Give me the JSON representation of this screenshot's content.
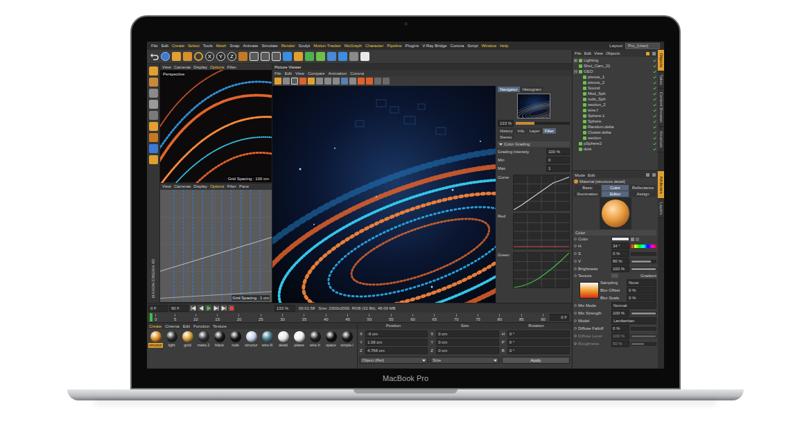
{
  "device": {
    "label": "MacBook Pro"
  },
  "menu_bar": {
    "items": [
      {
        "label": "File",
        "color": "#d6d6d6"
      },
      {
        "label": "Edit",
        "color": "#d6d6d6"
      },
      {
        "label": "Create",
        "color": "#e8c547"
      },
      {
        "label": "Select",
        "color": "#e8c547"
      },
      {
        "label": "Tools",
        "color": "#d6d6d6"
      },
      {
        "label": "Mesh",
        "color": "#e8c547"
      },
      {
        "label": "Snap",
        "color": "#d6d6d6"
      },
      {
        "label": "Animate",
        "color": "#d6d6d6"
      },
      {
        "label": "Simulate",
        "color": "#d6d6d6"
      },
      {
        "label": "Render",
        "color": "#e8c547"
      },
      {
        "label": "Sculpt",
        "color": "#d6d6d6"
      },
      {
        "label": "Motion Tracker",
        "color": "#e8c547"
      },
      {
        "label": "MoGraph",
        "color": "#e8c547"
      },
      {
        "label": "Character",
        "color": "#e8c547"
      },
      {
        "label": "Pipeline",
        "color": "#e8c547"
      },
      {
        "label": "Plugins",
        "color": "#d6d6d6"
      },
      {
        "label": "V-Ray Bridge",
        "color": "#d6d6d6"
      },
      {
        "label": "Corona",
        "color": "#d6d6d6"
      },
      {
        "label": "Script",
        "color": "#d6d6d6"
      },
      {
        "label": "Window",
        "color": "#e8c547"
      },
      {
        "label": "Help",
        "color": "#e8c547"
      }
    ],
    "layout_label": "Layout:",
    "layout_value": "Pro_(User)"
  },
  "toolbar": {
    "axes": [
      "X",
      "Y",
      "Z"
    ]
  },
  "brand": "MAXON CINEMA 4D",
  "viewports": [
    {
      "menu": [
        {
          "label": "View",
          "highlighted": false
        },
        {
          "label": "Cameras",
          "highlighted": false
        },
        {
          "label": "Display",
          "highlighted": false
        },
        {
          "label": "Options",
          "highlighted": true
        },
        {
          "label": "Filter",
          "highlighted": false
        }
      ],
      "label": "Perspective",
      "grid": "Grid Spacing : 100 cm"
    },
    {
      "menu": [
        {
          "label": "View",
          "highlighted": false
        },
        {
          "label": "Cameras",
          "highlighted": false
        },
        {
          "label": "Display",
          "highlighted": false
        },
        {
          "label": "Options",
          "highlighted": true
        },
        {
          "label": "Filter",
          "highlighted": false
        },
        {
          "label": "Pane",
          "highlighted": false
        }
      ],
      "grid": "Grid Spacing : 1 cm"
    }
  ],
  "picture_viewer": {
    "title": "Picture Viewer",
    "menu": [
      "File",
      "Edit",
      "View",
      "Compare",
      "Animation",
      "Corona"
    ],
    "side": {
      "tabs": [
        {
          "label": "Navigator",
          "selected": true
        },
        {
          "label": "Histogram",
          "selected": false
        }
      ],
      "zoom": "133 %",
      "zoom_level": 0.35,
      "tabs2": [
        {
          "label": "History",
          "selected": false
        },
        {
          "label": "Info",
          "selected": false
        },
        {
          "label": "Layer",
          "selected": false
        },
        {
          "label": "Filter",
          "selected": true
        },
        {
          "label": "Stereo",
          "selected": false
        }
      ],
      "section": "Color Grading",
      "fields": [
        {
          "label": "Grading Intensity",
          "value": "100 %"
        },
        {
          "label": "Min",
          "value": "0"
        },
        {
          "label": "Max",
          "value": "1"
        }
      ],
      "graphs": [
        {
          "label": "Curve",
          "color": "#d0d0d0",
          "values": [
            0,
            0.14,
            0.3,
            0.46,
            0.62,
            0.78,
            0.86,
            0.95
          ]
        },
        {
          "label": "Red",
          "color": "#d04848",
          "values": [
            0.06,
            0.06,
            0.06,
            0.06,
            0.06,
            0.06,
            0.06,
            0.06
          ]
        },
        {
          "label": "Green",
          "color": "#44c044",
          "values": [
            0,
            0.04,
            0.12,
            0.24,
            0.4,
            0.58,
            0.78,
            1
          ]
        }
      ]
    },
    "status": {
      "zoom": "133 %",
      "time": "00:01:58",
      "info": "Size: 2000x2000, RGB (32 Bit), 48.09 MB"
    }
  },
  "transport": {
    "start": "0 F",
    "end": "90 F"
  },
  "timeline": {
    "ticks": [
      "0",
      "5",
      "10",
      "15",
      "20",
      "25",
      "30",
      "35",
      "40",
      "45",
      "50",
      "55",
      "60",
      "65",
      "70",
      "75",
      "80",
      "85",
      "90"
    ],
    "playhead_level": 0,
    "current": "0 F"
  },
  "materials": {
    "menu": [
      {
        "label": "Create",
        "highlighted": true
      },
      {
        "label": "Cinema",
        "highlighted": false
      },
      {
        "label": "Edit",
        "highlighted": false
      },
      {
        "label": "Function",
        "highlighted": false
      },
      {
        "label": "Texture",
        "highlighted": false
      }
    ],
    "items": [
      {
        "label": "structur",
        "color": "#e0902c",
        "selected": true
      },
      {
        "label": "light",
        "color": "#2a2a2a",
        "selected": false
      },
      {
        "label": "gold",
        "color": "#d9a23a",
        "selected": false
      },
      {
        "label": "mass.2",
        "color": "#333333",
        "selected": false
      },
      {
        "label": "black",
        "color": "#1a1a1a",
        "selected": false
      },
      {
        "label": "rods",
        "color": "#151515",
        "selected": false
      },
      {
        "label": "structur",
        "color": "#c9d4ea",
        "selected": false
      },
      {
        "label": "wire.fil",
        "color": "#4a7d8c",
        "selected": false
      },
      {
        "label": "detail",
        "color": "#e8e8e8",
        "selected": false
      },
      {
        "label": "plates",
        "color": "#f0f0f0",
        "selected": false
      },
      {
        "label": "wire.fr",
        "color": "#202020",
        "selected": false
      },
      {
        "label": "space",
        "color": "#101010",
        "selected": false
      },
      {
        "label": "simple.l",
        "color": "#181818",
        "selected": false
      }
    ]
  },
  "coordinates": {
    "headers": [
      "Position",
      "Size",
      "Rotation"
    ],
    "rows": [
      {
        "pos_axis": "X",
        "pos": "-6 cm",
        "size_axis": "X",
        "size": "0 cm",
        "rot_axis": "H",
        "rot": "0 °"
      },
      {
        "pos_axis": "Y",
        "pos": "1.09 cm",
        "size_axis": "Y",
        "size": "0 cm",
        "rot_axis": "P",
        "rot": "0 °"
      },
      {
        "pos_axis": "Z",
        "pos": "4.766 cm",
        "size_axis": "Z",
        "size": "0 cm",
        "rot_axis": "B",
        "rot": "0 °"
      }
    ],
    "mode": "Object (Rel)",
    "size_mode": "Size",
    "apply": "Apply"
  },
  "objects": {
    "menu": [
      "File",
      "Edit",
      "View",
      "Objects"
    ],
    "items": [
      {
        "name": "Lighting",
        "expanded": false
      },
      {
        "name": "Shot_Cam_21"
      },
      {
        "name": "GEO",
        "expanded": true,
        "children": [
          {
            "name": "plexus_1"
          },
          {
            "name": "plexus_2"
          },
          {
            "name": "Sound"
          },
          {
            "name": "Mod_Sph"
          },
          {
            "name": "rods_Sph"
          },
          {
            "name": "section_2"
          },
          {
            "name": "wire.f"
          },
          {
            "name": "Sphere.1"
          },
          {
            "name": "Sphere"
          },
          {
            "name": "Random.delta"
          },
          {
            "name": "Cluster.delta"
          },
          {
            "name": "section"
          }
        ]
      },
      {
        "name": "pSphere2"
      },
      {
        "name": "dots"
      }
    ]
  },
  "attributes": {
    "menu": [
      "Mode",
      "Edit"
    ],
    "title": "Material [structure.detail]",
    "tabs": [
      {
        "label": "Basic",
        "selected": false
      },
      {
        "label": "Color",
        "selected": true
      },
      {
        "label": "Reflectance",
        "selected": false
      },
      {
        "label": "Illumination",
        "selected": false
      },
      {
        "label": "Editor",
        "selected": true
      },
      {
        "label": "Assign",
        "selected": false
      }
    ],
    "section": "Color",
    "rows": [
      {
        "kind": "color",
        "label": "Color",
        "color": "#e6e6e6",
        "disabled": false
      },
      {
        "kind": "hue",
        "label": "H",
        "value": "34 °",
        "level": 0.09,
        "disabled": false
      },
      {
        "kind": "slider",
        "label": "S",
        "value": "0 %",
        "level": 0,
        "disabled": false
      },
      {
        "kind": "slider",
        "label": "V",
        "value": "80 %",
        "level": 0.8,
        "disabled": false
      },
      {
        "kind": "slider",
        "label": "Brightness",
        "value": "100 %",
        "level": 1,
        "disabled": false
      },
      {
        "kind": "link",
        "label": "Texture",
        "value": "Gradient",
        "disabled": false
      },
      {
        "kind": "gradient",
        "fields": [
          {
            "label": "Sampling",
            "value": "None"
          },
          {
            "label": "Blur Offset",
            "value": "0 %"
          },
          {
            "label": "Blur Scale",
            "value": "0 %"
          }
        ],
        "disabled": false
      },
      {
        "kind": "dropdown",
        "label": "Mix Mode",
        "value": "Normal",
        "disabled": false
      },
      {
        "kind": "slider",
        "label": "Mix Strength",
        "value": "100 %",
        "level": 1,
        "disabled": false
      },
      {
        "kind": "dropdown",
        "label": "Model",
        "value": "Lambertian",
        "disabled": false
      },
      {
        "kind": "slider",
        "label": "Diffuse Falloff",
        "value": "0 %",
        "level": 0,
        "disabled": false
      },
      {
        "kind": "slider",
        "label": "Diffuse Level",
        "value": "100 %",
        "level": 1,
        "disabled": true
      },
      {
        "kind": "slider",
        "label": "Roughness",
        "value": "50 %",
        "level": 0.5,
        "disabled": true
      }
    ]
  },
  "side_tabs": {
    "top": [
      {
        "label": "Objects",
        "selected": true
      },
      {
        "label": "Takes",
        "selected": false
      },
      {
        "label": "Content Browser",
        "selected": false
      },
      {
        "label": "Structure",
        "selected": false
      }
    ],
    "bottom": [
      {
        "label": "Attributes",
        "selected": true
      },
      {
        "label": "Layers",
        "selected": false
      }
    ]
  }
}
